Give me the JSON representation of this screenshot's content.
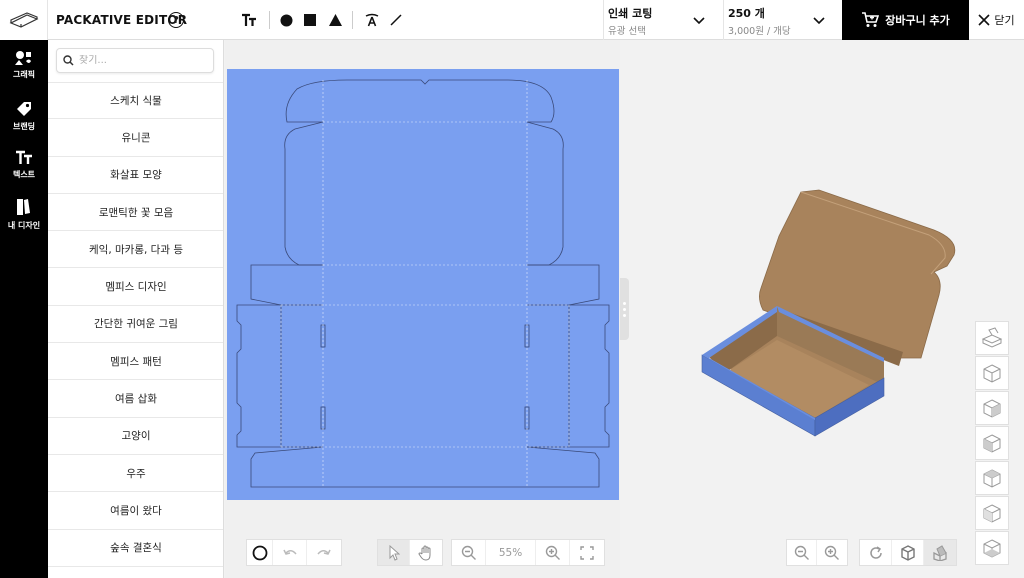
{
  "app": {
    "title": "PACKATIVE EDITOR",
    "help_icon": "question-circle-icon",
    "logo_icon": "box-logo-icon"
  },
  "toolbar": {
    "tools": [
      {
        "name": "text-tool",
        "icon": "text-tt-icon"
      },
      {
        "name": "circle-tool",
        "icon": "circle-filled-icon"
      },
      {
        "name": "square-tool",
        "icon": "square-filled-icon"
      },
      {
        "name": "triangle-tool",
        "icon": "triangle-filled-icon"
      },
      {
        "name": "text-path-tool",
        "icon": "text-curve-icon"
      },
      {
        "name": "line-tool",
        "icon": "line-icon"
      }
    ],
    "coating": {
      "title": "인쇄 코팅",
      "value": "유광 선택"
    },
    "quantity": {
      "title": "250 개",
      "value": "3,000원 / 개당"
    },
    "cart_label": "장바구니 추가",
    "close_label": "닫기"
  },
  "rail": {
    "items": [
      {
        "label": "그래픽",
        "icon": "shapes-icon"
      },
      {
        "label": "브랜딩",
        "icon": "tag-icon"
      },
      {
        "label": "텍스트",
        "icon": "text-icon"
      },
      {
        "label": "내 디자인",
        "icon": "my-design-icon"
      }
    ]
  },
  "panel": {
    "search_placeholder": "찾기...",
    "categories": [
      "스케치 식물",
      "유니콘",
      "화살표 모양",
      "로맨틱한 꽃 모음",
      "케익, 마카롱, 다과 등",
      "멤피스 디자인",
      "간단한 귀여운 그림",
      "멤피스 패턴",
      "여름 삽화",
      "고양이",
      "우주",
      "여름이 왔다",
      "숲속 결혼식"
    ]
  },
  "canvas": {
    "dieline_color": "#7a9ff0",
    "zoom": "55%"
  },
  "preview": {
    "box_inner_color": "#a8835c",
    "box_outer_color": "#5b7fd1"
  },
  "colors": {
    "accent": "#000000",
    "rail_bg": "#000000"
  }
}
